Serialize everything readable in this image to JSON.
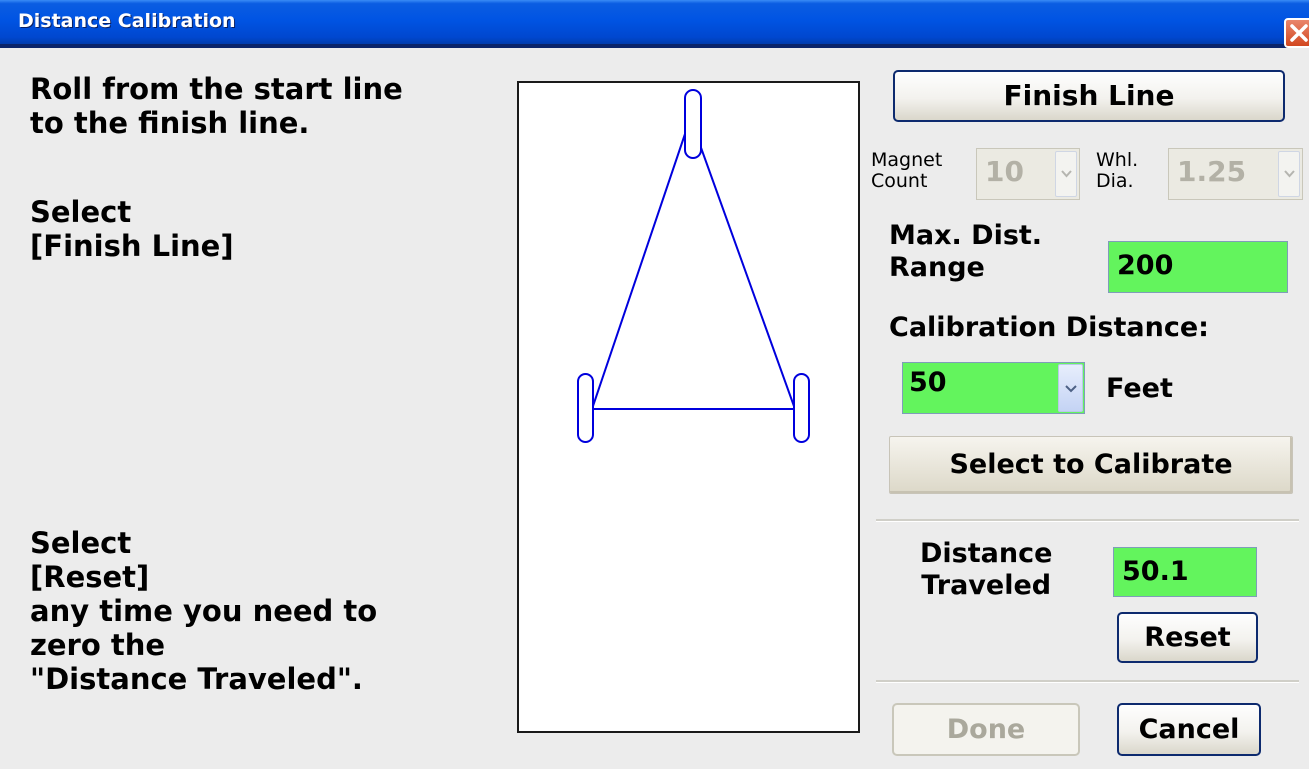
{
  "window": {
    "title": "Distance Calibration"
  },
  "instructions": {
    "line1": "Roll from the start line\nto the finish line.",
    "line2": "Select\n[Finish Line]",
    "line3": "Select\n[Reset]\nany time you need to\nzero the\n\"Distance Traveled\"."
  },
  "controls": {
    "finish_line_label": "Finish Line",
    "magnet_count_label": "Magnet\nCount",
    "magnet_count_value": "10",
    "wheel_dia_label": "Whl.\nDia.",
    "wheel_dia_value": "1.25",
    "max_dist_label": "Max. Dist.\nRange",
    "max_dist_value": "200",
    "calibration_distance_label": "Calibration Distance:",
    "calibration_distance_value": "50",
    "calibration_unit": "Feet",
    "select_to_calibrate_label": "Select to Calibrate",
    "distance_traveled_label": "Distance\nTraveled",
    "distance_traveled_value": "50.1",
    "reset_label": "Reset",
    "done_label": "Done",
    "cancel_label": "Cancel"
  },
  "colors": {
    "field_green": "#63f45d",
    "drawing_blue": "#0000dd",
    "titlebar_blue": "#0054e3"
  },
  "icons": {
    "close": "close-icon",
    "dropdown": "chevron-down-icon"
  }
}
